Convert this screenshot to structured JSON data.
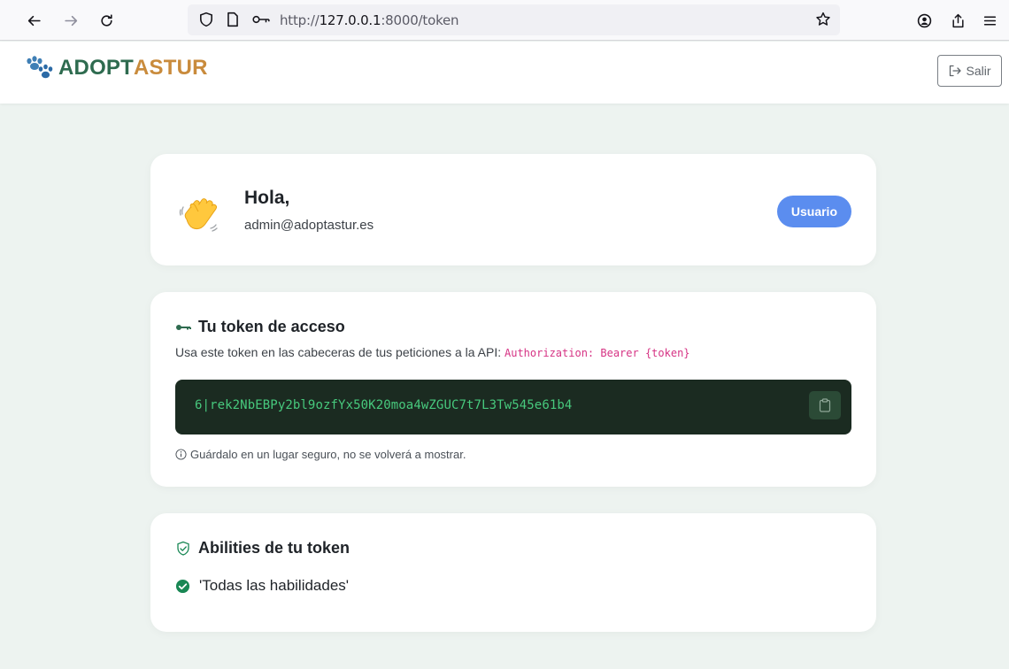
{
  "browser": {
    "url_prefix": "http://",
    "url_host": "127.0.0.1",
    "url_suffix": ":8000/token"
  },
  "header": {
    "brand_part1": "ADOPT",
    "brand_part2": "ASTUR",
    "logout_label": "Salir"
  },
  "hello": {
    "title": "Hola,",
    "email": "admin@adoptastur.es",
    "role": "Usuario"
  },
  "token": {
    "title": "Tu token de acceso",
    "description": "Usa este token en las cabeceras de tus peticiones a la API:",
    "header_example": "Authorization: Bearer {token}",
    "value": "6|rek2NbEBPy2bl9ozfYx50K20moa4wZGUC7t7L3Tw545e61b4",
    "note": "Guárdalo en un lugar seguro, no se volverá a mostrar."
  },
  "abilities": {
    "title": "Abilities de tu token",
    "items": [
      "'Todas las habilidades'"
    ]
  },
  "colors": {
    "brand_green": "#2e6b4f",
    "brand_orange": "#c98b3c",
    "badge_blue": "#5b8def",
    "token_bg": "#1b2b21",
    "token_text": "#47c97d",
    "code_pink": "#d63384",
    "check_green": "#198754"
  },
  "icons": {
    "back": "arrow-left-icon",
    "forward": "arrow-right-icon",
    "reload": "reload-icon",
    "shield": "shield-icon",
    "page": "page-icon",
    "key": "key-icon",
    "star": "star-icon",
    "account": "account-icon",
    "share": "share-icon",
    "menu": "menu-icon",
    "paw": "paw-icon",
    "logout": "logout-icon",
    "wave": "waving-hand-icon",
    "copy": "clipboard-icon",
    "info": "info-icon",
    "shield_check": "shield-check-icon",
    "check": "check-circle-icon"
  }
}
